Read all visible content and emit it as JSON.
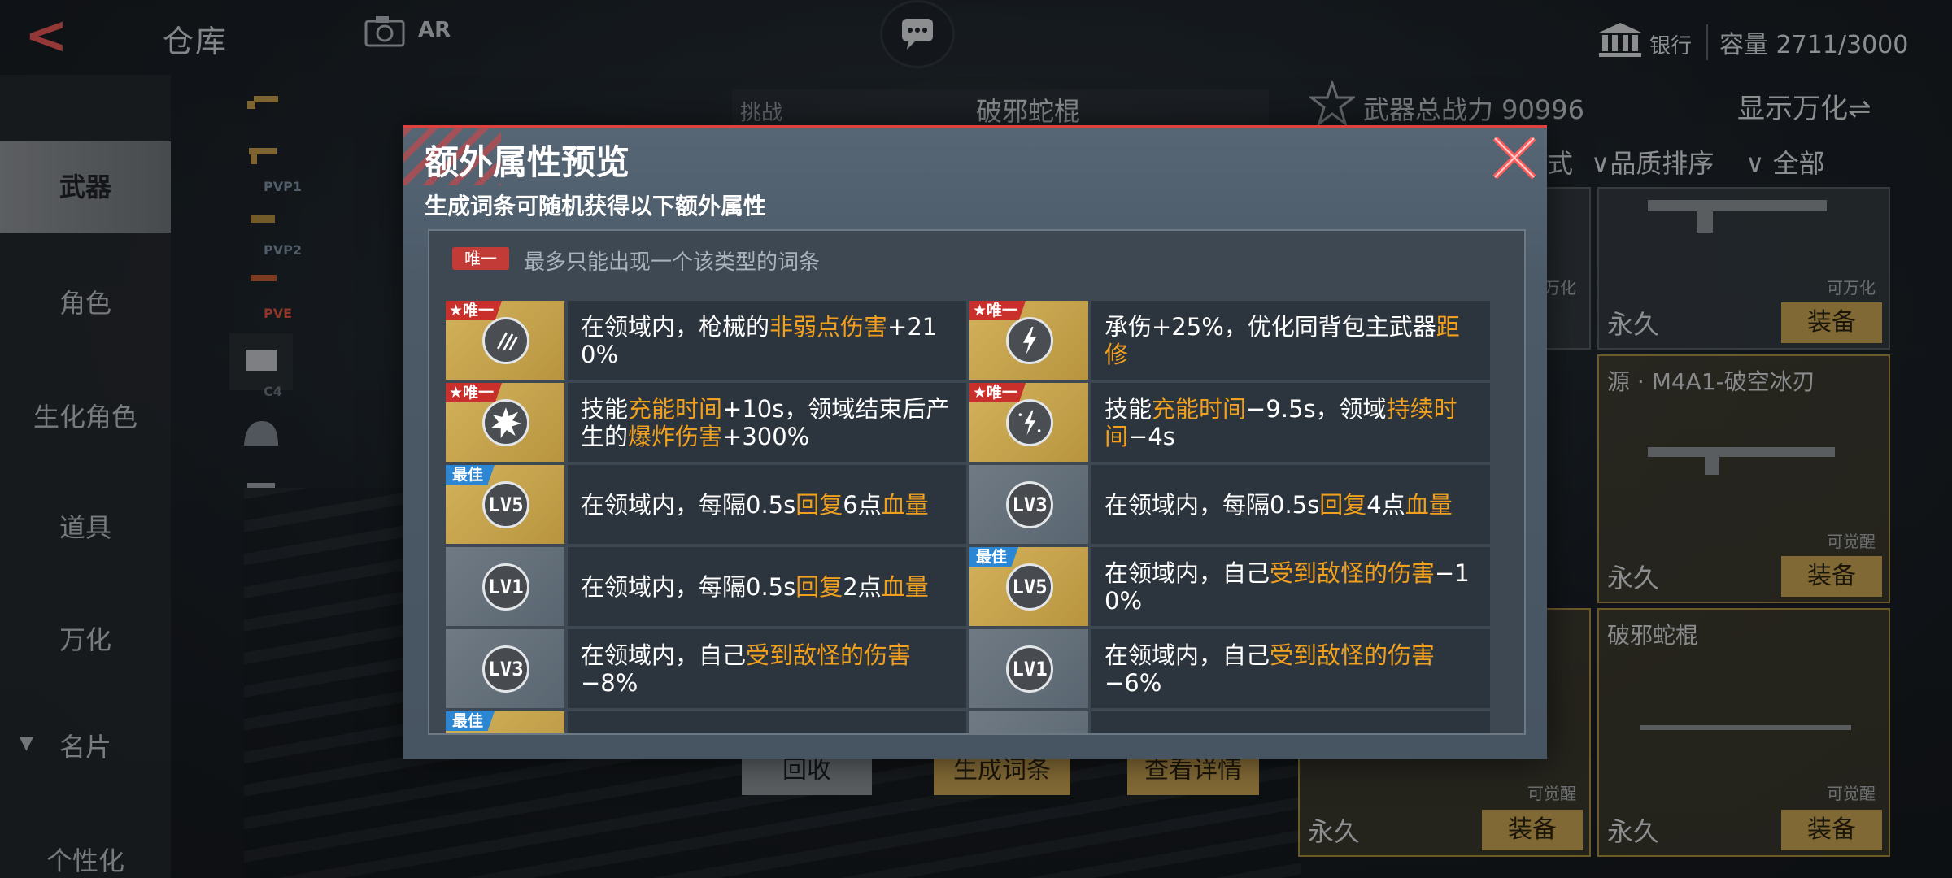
{
  "header": {
    "title": "仓库",
    "ar_label": "AR",
    "bank_label": "银行",
    "capacity": "容量 2711/3000"
  },
  "sidebar": {
    "items": [
      {
        "label": "武器",
        "active": true
      },
      {
        "label": "角色"
      },
      {
        "label": "生化角色"
      },
      {
        "label": "道具"
      },
      {
        "label": "万化"
      },
      {
        "label": "名片"
      },
      {
        "label": "个性化"
      }
    ]
  },
  "subnav_tags": [
    "PVP1",
    "PVP2",
    "PVE",
    "C4"
  ],
  "background": {
    "challenge": "挑战",
    "weapon_name": "破邪蛇棍",
    "power": "武器总战力 90996",
    "show_wanhua": "显示万化⇌",
    "filters": [
      "式",
      "品质排序",
      "全部"
    ],
    "buttons": [
      "回收",
      "生成词条",
      "查看详情"
    ],
    "cards": {
      "permanent": "永久",
      "equip": "装备",
      "tag_wanhua": "可万化",
      "tag_awaken": "可觉醒",
      "card2_name": "源 · M4A1-破空冰刃",
      "card3_name": "破邪蛇棍",
      "left_tag_1": "可万化",
      "left_tag_2": "可觉醒",
      "left_tag_3": "可觉醒"
    }
  },
  "modal": {
    "title": "额外属性预览",
    "subtitle": "生成词条可随机获得以下额外属性",
    "legend_badge": "唯一",
    "legend_text": "最多只能出现一个该类型的词条",
    "badge_unique": "★唯一",
    "badge_best": "最佳",
    "rows": [
      {
        "left": {
          "badge": "unique",
          "icon": "bullets-icon",
          "tone": "gold",
          "parts": [
            {
              "t": "在领域内，枪械的"
            },
            {
              "t": "非弱点伤害",
              "hl": true
            },
            {
              "t": "+210%"
            }
          ]
        },
        "right": {
          "badge": "unique",
          "icon": "lightning-icon",
          "tone": "gold",
          "parts": [
            {
              "t": "承伤+25%，优化同背包主武器"
            },
            {
              "t": "距修",
              "hl": true
            }
          ]
        }
      },
      {
        "left": {
          "badge": "unique",
          "icon": "explosion-icon",
          "tone": "gold",
          "parts": [
            {
              "t": "技能"
            },
            {
              "t": "充能时间",
              "hl": true
            },
            {
              "t": "+10s，领域结束后产生的"
            },
            {
              "t": "爆炸伤害",
              "hl": true
            },
            {
              "t": "+300%"
            }
          ]
        },
        "right": {
          "badge": "unique",
          "icon": "lightning-sparkle-icon",
          "tone": "gold",
          "parts": [
            {
              "t": "技能"
            },
            {
              "t": "充能时间",
              "hl": true
            },
            {
              "t": "−9.5s，领域"
            },
            {
              "t": "持续时间",
              "hl": true
            },
            {
              "t": "−4s"
            }
          ]
        }
      },
      {
        "left": {
          "badge": "best",
          "lv": "LV5",
          "tone": "gold",
          "parts": [
            {
              "t": "在领域内，每隔0.5s"
            },
            {
              "t": "回复",
              "hl": true
            },
            {
              "t": "6点"
            },
            {
              "t": "血量",
              "hl": true
            }
          ]
        },
        "right": {
          "badge": "",
          "lv": "LV3",
          "tone": "gray",
          "parts": [
            {
              "t": "在领域内，每隔0.5s"
            },
            {
              "t": "回复",
              "hl": true
            },
            {
              "t": "4点"
            },
            {
              "t": "血量",
              "hl": true
            }
          ]
        }
      },
      {
        "left": {
          "badge": "",
          "lv": "LV1",
          "tone": "gray",
          "parts": [
            {
              "t": "在领域内，每隔0.5s"
            },
            {
              "t": "回复",
              "hl": true
            },
            {
              "t": "2点"
            },
            {
              "t": "血量",
              "hl": true
            }
          ]
        },
        "right": {
          "badge": "best",
          "lv": "LV5",
          "tone": "gold",
          "parts": [
            {
              "t": "在领域内，自己"
            },
            {
              "t": "受到敌怪的伤害",
              "hl": true
            },
            {
              "t": "−10%"
            }
          ]
        }
      },
      {
        "left": {
          "badge": "",
          "lv": "LV3",
          "tone": "gray",
          "parts": [
            {
              "t": "在领域内，自己"
            },
            {
              "t": "受到敌怪的伤害",
              "hl": true
            },
            {
              "t": "−8%"
            }
          ]
        },
        "right": {
          "badge": "",
          "lv": "LV1",
          "tone": "gray",
          "parts": [
            {
              "t": "在领域内，自己"
            },
            {
              "t": "受到敌怪的伤害",
              "hl": true
            },
            {
              "t": "−6%"
            }
          ]
        }
      },
      {
        "left": {
          "badge": "best",
          "lv": "",
          "tone": "gold",
          "parts": []
        },
        "right": {
          "badge": "",
          "lv": "",
          "tone": "gray",
          "parts": []
        }
      }
    ]
  },
  "colors": {
    "accent_red": "#e0413f",
    "highlight_orange": "#f0a01e",
    "gold": "#c9a454",
    "best_blue": "#2b86d4"
  }
}
